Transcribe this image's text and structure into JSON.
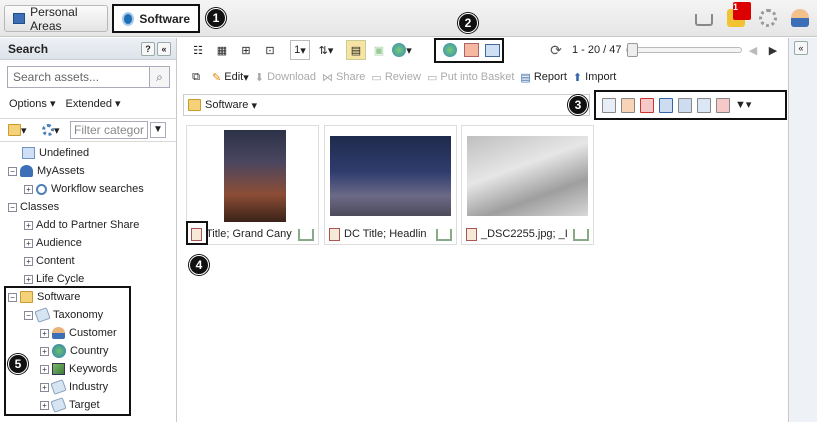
{
  "tabs": [
    {
      "label": "Personal Areas"
    },
    {
      "label": "Software"
    }
  ],
  "callouts": [
    "1",
    "2",
    "3",
    "4",
    "5"
  ],
  "notification_count": "1",
  "search": {
    "title": "Search",
    "placeholder": "Search assets...",
    "options_label": "Options",
    "extended_label": "Extended",
    "filter_placeholder": "Filter categor"
  },
  "tree": [
    {
      "label": "Undefined"
    },
    {
      "label": "MyAssets"
    },
    {
      "label": "Workflow searches"
    },
    {
      "label": "Classes"
    },
    {
      "label": "Add to Partner Share"
    },
    {
      "label": "Audience"
    },
    {
      "label": "Content"
    },
    {
      "label": "Life Cycle"
    },
    {
      "label": "Software"
    },
    {
      "label": "Taxonomy"
    },
    {
      "label": "Customer"
    },
    {
      "label": "Country"
    },
    {
      "label": "Keywords"
    },
    {
      "label": "Industry"
    },
    {
      "label": "Target"
    }
  ],
  "toolbar": {
    "page_size": "1",
    "pagination": "1 - 20 / 47",
    "edit": "Edit",
    "download": "Download",
    "share": "Share",
    "review": "Review",
    "basket": "Put into Basket",
    "report": "Report",
    "import": "Import"
  },
  "path": {
    "folder": "Software"
  },
  "assets": [
    {
      "caption": "Title; Grand Cany"
    },
    {
      "caption": "DC Title; Headlin"
    },
    {
      "caption": "_DSC2255.jpg; _I"
    }
  ]
}
